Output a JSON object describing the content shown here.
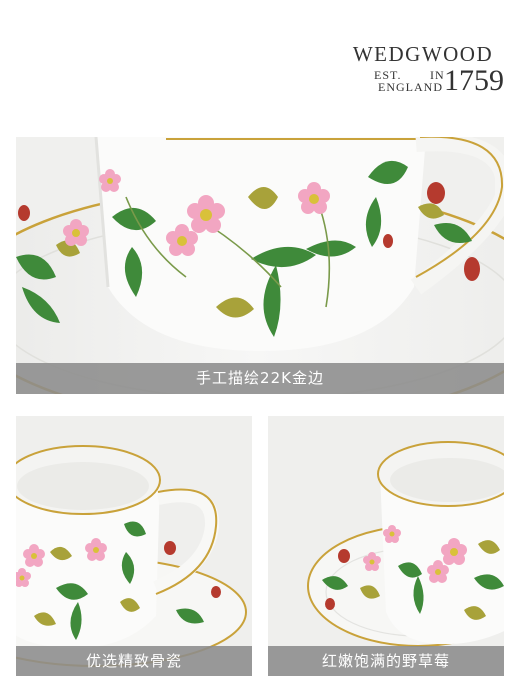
{
  "brand": {
    "name": "WEDGWOOD",
    "est": "EST.",
    "in": "IN",
    "england": "ENGLAND",
    "year": "1759"
  },
  "panels": [
    {
      "caption": "手工描绘22K金边"
    },
    {
      "caption": "优选精致骨瓷"
    },
    {
      "caption": "红嫩饱满的野草莓"
    }
  ],
  "colors": {
    "gold_rim": "#c9a23a",
    "caption_bg": "#8c8c8c",
    "leaf_green": "#3f8a3a",
    "blossom_pink": "#f2a6c2",
    "strawberry_red": "#b53a2e"
  }
}
